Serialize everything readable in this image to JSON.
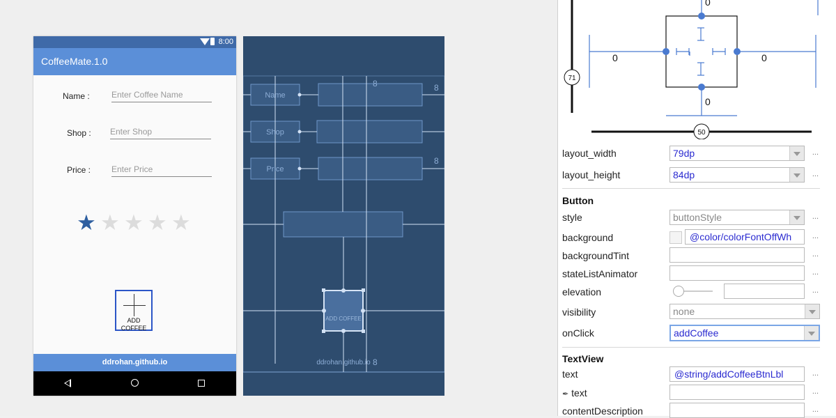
{
  "phone": {
    "status_time": "8:00",
    "app_title": "CoffeeMate.1.0",
    "fields": [
      {
        "label": "Name :",
        "placeholder": "Enter Coffee Name"
      },
      {
        "label": "Shop :",
        "placeholder": "Enter Shop"
      },
      {
        "label": "Price :",
        "placeholder": "Enter Price"
      }
    ],
    "rating": {
      "value": 1,
      "max": 5
    },
    "add_button_line1": "ADD",
    "add_button_line2": "COFFEE",
    "footer": "ddrohan.github.io"
  },
  "blueprint": {
    "labels": [
      "Name",
      "Shop",
      "Price"
    ],
    "margin_values": [
      "8",
      "8",
      "8",
      "8"
    ],
    "button_text": "ADD COFFEE",
    "footer": "ddrohan.github.io"
  },
  "inspector": {
    "top_margin": "0",
    "left_margin": "0",
    "right_margin": "0",
    "bottom_margin": "0",
    "vertical_bias": "71",
    "horizontal_bias": "50"
  },
  "attributes": {
    "layout_width": {
      "label": "layout_width",
      "value": "79dp"
    },
    "layout_height": {
      "label": "layout_height",
      "value": "84dp"
    },
    "button_section": "Button",
    "style": {
      "label": "style",
      "value": "buttonStyle"
    },
    "background": {
      "label": "background",
      "value": "@color/colorFontOffWh"
    },
    "backgroundTint": {
      "label": "backgroundTint",
      "value": ""
    },
    "stateListAnimator": {
      "label": "stateListAnimator",
      "value": ""
    },
    "elevation": {
      "label": "elevation",
      "value": ""
    },
    "visibility": {
      "label": "visibility",
      "value": "none"
    },
    "onClick": {
      "label": "onClick",
      "value": "addCoffee"
    },
    "textview_section": "TextView",
    "text": {
      "label": "text",
      "value": "@string/addCoffeeBtnLbl"
    },
    "tools_text": {
      "label": "text",
      "value": ""
    },
    "contentDescription": {
      "label": "contentDescription",
      "value": ""
    },
    "more_label": "..."
  },
  "colors": {
    "app_bar": "#5b8fd8",
    "status_bar": "#3f6aa8",
    "blueprint_bg": "#2e4c6e",
    "value_text": "#2a2ad0",
    "star_on": "#2e5fa0"
  }
}
